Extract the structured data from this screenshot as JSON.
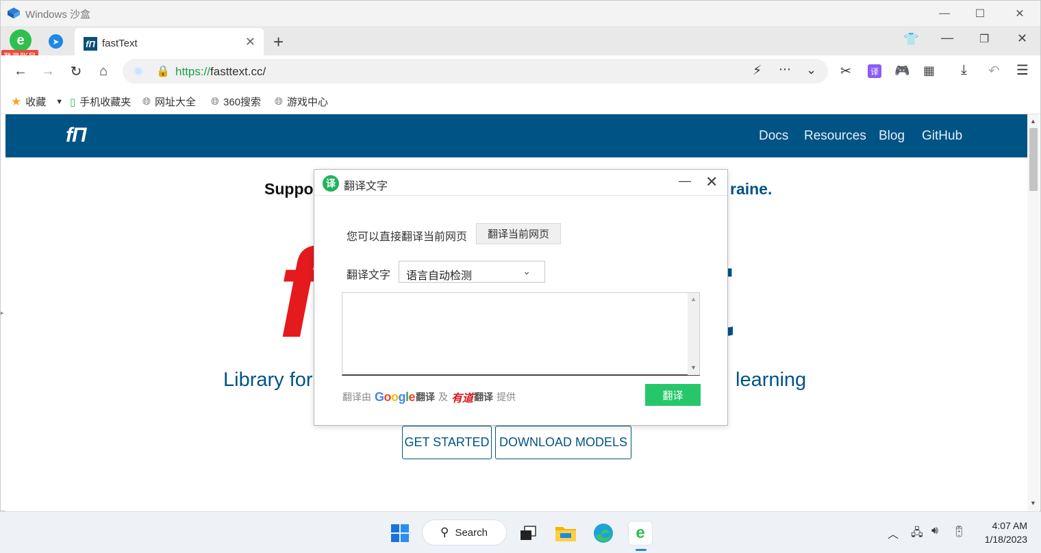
{
  "window": {
    "title": "Windows 沙盒"
  },
  "browser": {
    "login_badge": "登录账号",
    "tab": {
      "label": "fastText",
      "favicon_text": "fΠ"
    },
    "url": {
      "scheme": "https://",
      "host": "fasttext.cc/"
    },
    "bookmarks": [
      {
        "label": "收藏"
      },
      {
        "label": "手机收藏夹"
      },
      {
        "label": "网址大全"
      },
      {
        "label": "360搜索"
      },
      {
        "label": "游戏中心"
      }
    ],
    "toolbar_translate_badge": "译"
  },
  "site": {
    "logo": "fΠ",
    "nav": [
      "Docs",
      "Resources",
      "Blog",
      "GitHub"
    ],
    "banner_left": "Suppo",
    "banner_right": "raine.",
    "hero_left": "f",
    "hero_right": "t",
    "tagline_left": "Library for",
    "tagline_right": "learning",
    "buttons": {
      "get_started": "GET STARTED",
      "download": "DOWNLOAD MODELS"
    }
  },
  "dialog": {
    "logo": "译",
    "title": "翻译文字",
    "page_prompt": "您可以直接翻译当前网页",
    "page_button": "翻译当前网页",
    "text_label": "翻译文字",
    "language_value": "语言自动检测",
    "footer_prefix": "翻译由",
    "google": "Google",
    "google_suffix": "翻译",
    "and": "及",
    "youdao": "有道",
    "youdao_suffix": "翻译",
    "footer_suffix": "提供",
    "translate_button": "翻译"
  },
  "taskbar": {
    "search_label": "Search",
    "time": "4:07 AM",
    "date": "1/18/2023"
  },
  "colors": {
    "site_header": "#005385",
    "accent_red": "#e41a1c",
    "translate_green": "#26c76b",
    "url_green": "#17a34a"
  }
}
